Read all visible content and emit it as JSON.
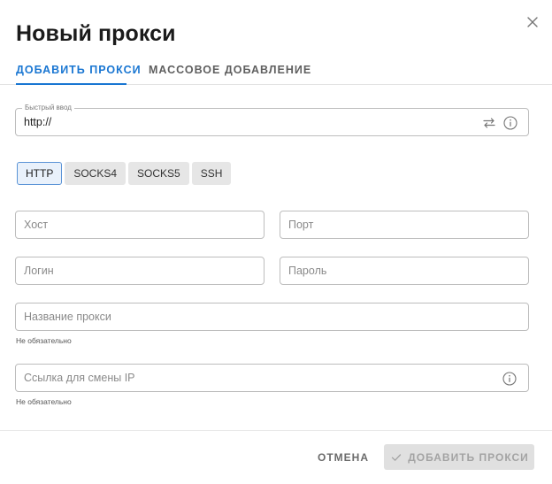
{
  "dialog": {
    "title": "Новый прокси",
    "close_icon": "close-icon"
  },
  "tabs": [
    {
      "label": "ДОБАВИТЬ ПРОКСИ",
      "active": true
    },
    {
      "label": "МАССОВОЕ ДОБАВЛЕНИЕ",
      "active": false
    }
  ],
  "quick_input": {
    "label": "Быстрый ввод",
    "value": "http://",
    "icons": [
      "swap-icon",
      "info-icon"
    ]
  },
  "protocols": [
    {
      "label": "HTTP",
      "selected": true
    },
    {
      "label": "SOCKS4",
      "selected": false
    },
    {
      "label": "SOCKS5",
      "selected": false
    },
    {
      "label": "SSH",
      "selected": false
    }
  ],
  "fields": {
    "host": {
      "placeholder": "Хост",
      "value": ""
    },
    "port": {
      "placeholder": "Порт",
      "value": ""
    },
    "login": {
      "placeholder": "Логин",
      "value": ""
    },
    "password": {
      "placeholder": "Пароль",
      "value": ""
    },
    "proxy_name": {
      "placeholder": "Название прокси",
      "value": "",
      "helper": "Не обязательно"
    },
    "ip_change_link": {
      "placeholder": "Ссылка для смены IP",
      "value": "",
      "helper": "Не обязательно"
    }
  },
  "footer": {
    "cancel_label": "ОТМЕНА",
    "add_label": "ДОБАВИТЬ ПРОКСИ",
    "add_icon": "check-icon",
    "add_disabled": true
  },
  "colors": {
    "accent": "#1976d2",
    "selected_border": "#5a93d6",
    "disabled_bg": "#e0e0e0"
  }
}
